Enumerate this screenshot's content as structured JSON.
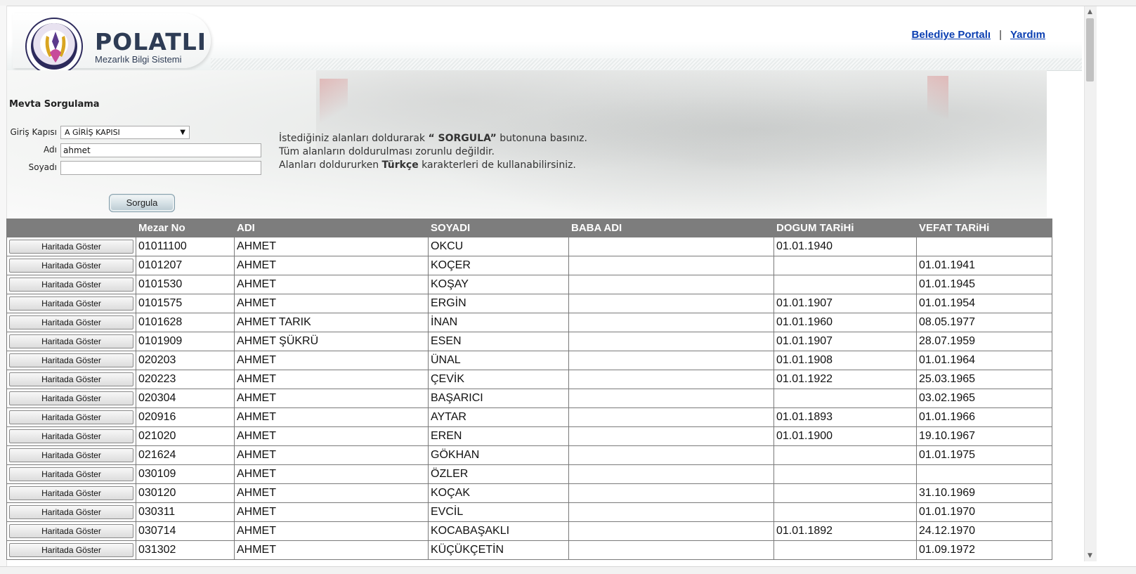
{
  "header": {
    "logo_title": "POLATLI",
    "logo_subtitle": "Mezarlık Bilgi Sistemi",
    "links": {
      "portal": "Belediye Portalı",
      "separator": "|",
      "help": "Yardım"
    }
  },
  "form": {
    "title": "Mevta Sorgulama",
    "gate_label": "Giriş Kapısı",
    "gate_value": "A GİRİŞ KAPISI",
    "name_label": "Adı",
    "name_value": "ahmet",
    "surname_label": "Soyadı",
    "surname_value": "",
    "submit_label": "Sorgula"
  },
  "info": {
    "line1_pre": "İstediğiniz alanları doldurarak ",
    "line1_bold": "“ SORGULA”",
    "line1_post": " butonuna basınız.",
    "line2": "Tüm alanların doldurulması zorunlu değildir.",
    "line3_pre": "Alanları doldururken ",
    "line3_bold": "Türkçe",
    "line3_post": " karakterleri de kullanabilirsiniz."
  },
  "table": {
    "columns": [
      "",
      "Mezar No",
      "ADI",
      "SOYADI",
      "BABA ADI",
      "DOGUM TARiHi",
      "VEFAT TARiHi"
    ],
    "button_label": "Haritada Göster",
    "rows": [
      [
        "01011100",
        "AHMET",
        "OKCU",
        "",
        "01.01.1940",
        ""
      ],
      [
        "0101207",
        "AHMET",
        "KOÇER",
        "",
        "",
        "01.01.1941"
      ],
      [
        "0101530",
        "AHMET",
        "KOŞAY",
        "",
        "",
        "01.01.1945"
      ],
      [
        "0101575",
        "AHMET",
        "ERGİN",
        "",
        "01.01.1907",
        "01.01.1954"
      ],
      [
        "0101628",
        "AHMET TARIK",
        "İNAN",
        "",
        "01.01.1960",
        "08.05.1977"
      ],
      [
        "0101909",
        "AHMET ŞÜKRÜ",
        "ESEN",
        "",
        "01.01.1907",
        "28.07.1959"
      ],
      [
        "020203",
        "AHMET",
        "ÜNAL",
        "",
        "01.01.1908",
        "01.01.1964"
      ],
      [
        "020223",
        "AHMET",
        "ÇEVİK",
        "",
        "01.01.1922",
        "25.03.1965"
      ],
      [
        "020304",
        "AHMET",
        "BAŞARICI",
        "",
        "",
        "03.02.1965"
      ],
      [
        "020916",
        "AHMET",
        "AYTAR",
        "",
        "01.01.1893",
        "01.01.1966"
      ],
      [
        "021020",
        "AHMET",
        "EREN",
        "",
        "01.01.1900",
        "19.10.1967"
      ],
      [
        "021624",
        "AHMET",
        "GÖKHAN",
        "",
        "",
        "01.01.1975"
      ],
      [
        "030109",
        "AHMET",
        "ÖZLER",
        "",
        "",
        ""
      ],
      [
        "030120",
        "AHMET",
        "KOÇAK",
        "",
        "",
        "31.10.1969"
      ],
      [
        "030311",
        "AHMET",
        "EVCİL",
        "",
        "",
        "01.01.1970"
      ],
      [
        "030714",
        "AHMET",
        "KOCABAŞAKLI",
        "",
        "01.01.1892",
        "24.12.1970"
      ],
      [
        "031302",
        "AHMET",
        "KÜÇÜKÇETİN",
        "",
        "",
        "01.09.1972"
      ]
    ]
  }
}
